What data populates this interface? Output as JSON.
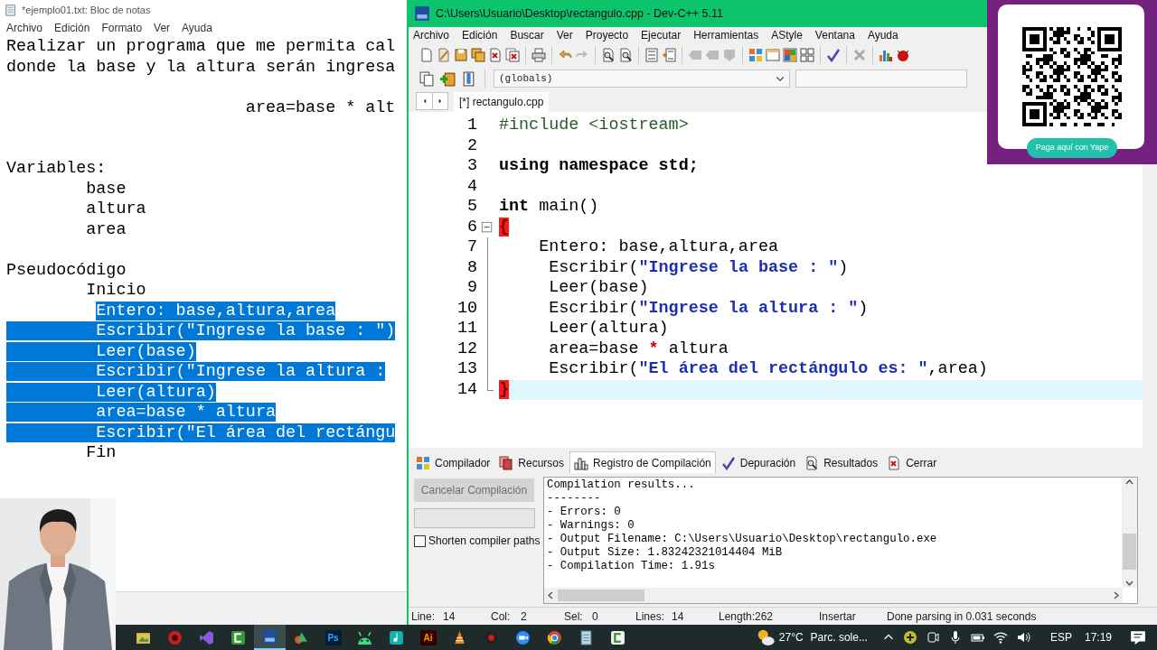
{
  "notepad": {
    "title": "*ejemplo01.txt: Bloc de notas",
    "menu": [
      "Archivo",
      "Edición",
      "Formato",
      "Ver",
      "Ayuda"
    ],
    "lines": [
      {
        "kind": "text",
        "text": "Realizar un programa que me permita cal",
        "selected": false
      },
      {
        "kind": "text",
        "text": "donde la base y la altura serán ingresa",
        "selected": false
      },
      {
        "kind": "blank"
      },
      {
        "kind": "text",
        "text": "                        area=base * alt",
        "selected": false
      },
      {
        "kind": "blank"
      },
      {
        "kind": "blank"
      },
      {
        "kind": "text",
        "text": "Variables:",
        "selected": false
      },
      {
        "kind": "text",
        "text": "        base",
        "selected": false
      },
      {
        "kind": "text",
        "text": "        altura",
        "selected": false
      },
      {
        "kind": "text",
        "text": "        area",
        "selected": false
      },
      {
        "kind": "blank"
      },
      {
        "kind": "text",
        "text": "Pseudocódigo",
        "selected": false
      },
      {
        "kind": "text",
        "text": "        Inicio",
        "selected": false
      },
      {
        "kind": "text",
        "text": "         Entero: base,altura,area",
        "selected": true
      },
      {
        "kind": "text",
        "text": "         Escribir(\"Ingrese la base : \")",
        "selected": true
      },
      {
        "kind": "text",
        "text": "         Leer(base)",
        "selected": true
      },
      {
        "kind": "text",
        "text": "         Escribir(\"Ingrese la altura :",
        "selected": true
      },
      {
        "kind": "text",
        "text": "         Leer(altura)",
        "selected": true
      },
      {
        "kind": "text",
        "text": "         area=base * altura",
        "selected": true
      },
      {
        "kind": "text",
        "text": "         Escribir(\"El área del rectángu",
        "selected": true
      },
      {
        "kind": "text",
        "text": "        Fin",
        "selected": false
      }
    ]
  },
  "devcpp": {
    "title": "C:\\Users\\Usuario\\Desktop\\rectangulo.cpp - Dev-C++ 5.11",
    "menu": [
      "Archivo",
      "Edición",
      "Buscar",
      "Ver",
      "Proyecto",
      "Ejecutar",
      "Herramientas",
      "AStyle",
      "Ventana",
      "Ayuda"
    ],
    "scope_dropdown": "(globals)",
    "tabs": [
      {
        "label": "[*] rectangulo.cpp",
        "selected": true
      }
    ],
    "code_lines": [
      {
        "number": "1",
        "current": false,
        "segments": [
          {
            "kind": "preprocessor",
            "text": "#include <iostream>"
          }
        ]
      },
      {
        "number": "2",
        "current": false
      },
      {
        "number": "3",
        "current": false,
        "segments": [
          {
            "kind": "keyword",
            "text": "using namespace std;"
          }
        ]
      },
      {
        "number": "4",
        "current": false
      },
      {
        "number": "5",
        "current": false,
        "segments": [
          {
            "kind": "keyword",
            "text": "int"
          },
          {
            "kind": "plain",
            "text": " main()"
          }
        ]
      },
      {
        "number": "6",
        "current": false,
        "fold_start": true,
        "segments": [
          {
            "kind": "brace",
            "text": "{"
          }
        ]
      },
      {
        "number": "7",
        "current": false,
        "segments": [
          {
            "kind": "plain",
            "text": "    Entero: base,altura,area"
          }
        ]
      },
      {
        "number": "8",
        "current": false,
        "segments": [
          {
            "kind": "plain",
            "text": "     Escribir("
          },
          {
            "kind": "string",
            "text": "\"Ingrese la base : \""
          },
          {
            "kind": "plain",
            "text": ")"
          }
        ]
      },
      {
        "number": "9",
        "current": false,
        "segments": [
          {
            "kind": "plain",
            "text": "     Leer(base)"
          }
        ]
      },
      {
        "number": "10",
        "current": false,
        "segments": [
          {
            "kind": "plain",
            "text": "     Escribir("
          },
          {
            "kind": "string",
            "text": "\"Ingrese la altura : \""
          },
          {
            "kind": "plain",
            "text": ")"
          }
        ]
      },
      {
        "number": "11",
        "current": false,
        "segments": [
          {
            "kind": "plain",
            "text": "     Leer(altura)"
          }
        ]
      },
      {
        "number": "12",
        "current": false,
        "segments": [
          {
            "kind": "plain",
            "text": "     area=base "
          },
          {
            "kind": "symbol",
            "text": "*"
          },
          {
            "kind": "plain",
            "text": " altura"
          }
        ]
      },
      {
        "number": "13",
        "current": false,
        "segments": [
          {
            "kind": "plain",
            "text": "     Escribir("
          },
          {
            "kind": "string",
            "text": "\"El área del rectángulo es: \""
          },
          {
            "kind": "plain",
            "text": ",area)"
          }
        ]
      },
      {
        "number": "14",
        "current": true,
        "fold_end": true,
        "segments": [
          {
            "kind": "brace",
            "text": "}"
          }
        ]
      }
    ],
    "bottom_tabs": [
      {
        "label": "Compilador",
        "selected": false
      },
      {
        "label": "Recursos",
        "selected": false
      },
      {
        "label": "Registro de Compilación",
        "selected": true
      },
      {
        "label": "Depuración",
        "selected": false
      },
      {
        "label": "Resultados",
        "selected": false
      },
      {
        "label": "Cerrar",
        "selected": false
      }
    ],
    "cancel_button": {
      "label": "Cancelar Compilación",
      "disabled": true
    },
    "shorten_paths": {
      "label": "Shorten compiler paths",
      "checked": false
    },
    "log": [
      "Compilation results...",
      "--------",
      "- Errors: 0",
      "- Warnings: 0",
      "- Output Filename: C:\\Users\\Usuario\\Desktop\\rectangulo.exe",
      "- Output Size: 1.83242321014404 MiB",
      "- Compilation Time: 1.91s"
    ],
    "status_bar": {
      "fields": [
        {
          "label": "Line:",
          "value": "14"
        },
        {
          "label": "Col:",
          "value": "2"
        },
        {
          "label": "Sel:",
          "value": "0"
        },
        {
          "label": "Lines:",
          "value": "14"
        },
        {
          "label": "Length:",
          "value": "262"
        }
      ],
      "mode": "Insertar",
      "message": "Done parsing in 0.031 seconds"
    }
  },
  "qr_overlay": {
    "button": "Paga aquí con Yape"
  },
  "taskbar": {
    "apps": [
      {
        "selected": false
      },
      {
        "selected": false
      },
      {
        "selected": false
      },
      {
        "selected": false
      },
      {
        "selected": true
      },
      {
        "selected": false
      },
      {
        "selected": false,
        "label": "Ps"
      },
      {
        "selected": false
      },
      {
        "selected": false
      },
      {
        "selected": false,
        "label": "Ai"
      },
      {
        "selected": false
      },
      {
        "selected": false
      },
      {
        "selected": false
      },
      {
        "selected": false
      },
      {
        "selected": false
      },
      {
        "selected": false
      }
    ],
    "temperature": "27°C",
    "weather": "Parc. sole...",
    "language": "ESP",
    "time": "17:19"
  }
}
